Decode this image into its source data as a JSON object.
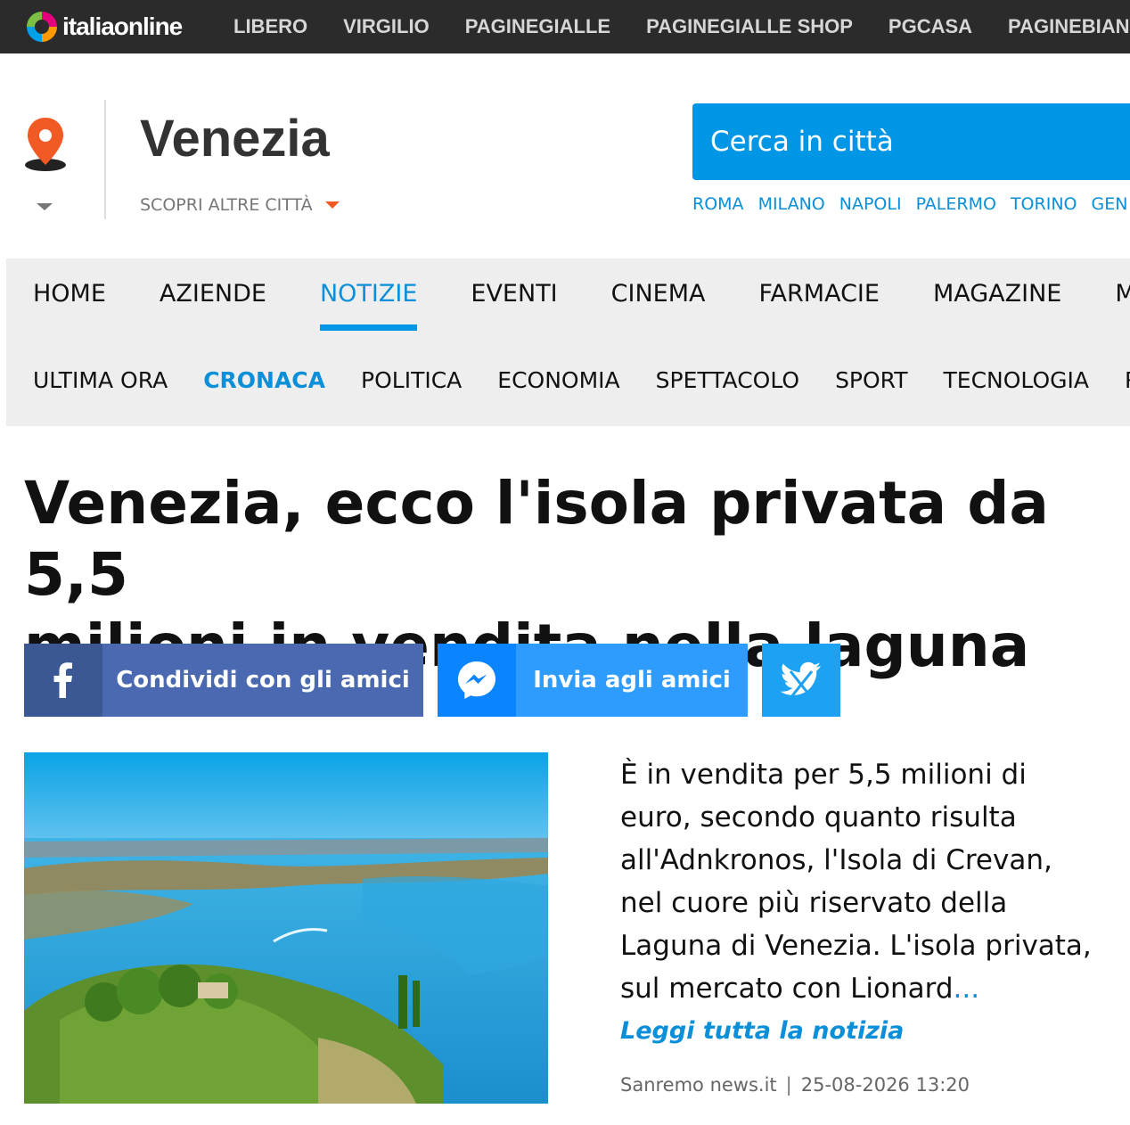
{
  "topbar": {
    "brand": "italiaonline",
    "links": [
      "LIBERO",
      "VIRGILIO",
      "PAGINEGIALLE",
      "PAGINEGIALLE SHOP",
      "PGCASA",
      "PAGINEBIAN"
    ]
  },
  "city": {
    "name": "Venezia",
    "other_cities": "SCOPRI ALTRE CITTÀ",
    "search_placeholder": "Cerca in città",
    "quick_links": [
      "ROMA",
      "MILANO",
      "NAPOLI",
      "PALERMO",
      "TORINO",
      "GEN"
    ]
  },
  "nav": {
    "main": [
      "HOME",
      "AZIENDE",
      "NOTIZIE",
      "EVENTI",
      "CINEMA",
      "FARMACIE",
      "MAGAZINE",
      "M"
    ],
    "main_active": "NOTIZIE",
    "sub": [
      "ULTIMA ORA",
      "CRONACA",
      "POLITICA",
      "ECONOMIA",
      "SPETTACOLO",
      "SPORT",
      "TECNOLOGIA",
      "RA"
    ],
    "sub_active": "CRONACA"
  },
  "article": {
    "headline_line1": "Venezia, ecco l'isola privata da 5,5",
    "headline_line2": "milioni in vendita nella laguna",
    "share_facebook": "Condividi con gli amici",
    "share_messenger": "Invia agli amici",
    "summary_lines": [
      "È in vendita per 5,5 milioni di",
      "euro, secondo quanto risulta",
      "all'Adnkronos, l'Isola di Crevan,",
      "nel cuore più riservato della",
      "Laguna di Venezia. L'isola privata,",
      "sul mercato con Lionard"
    ],
    "summary_ellipsis": "...",
    "read_more": "Leggi tutta la notizia",
    "source": "Sanremo news.it",
    "date": "25-08-2026 13:20"
  },
  "colors": {
    "accent": "#0a8fd8",
    "topbar_bg": "#2b2b2b",
    "facebook": "#4a69b0",
    "messenger": "#2e9bff",
    "twitter": "#1da1f2",
    "pin": "#f15a24"
  },
  "icons": [
    "location-pin-icon",
    "caret-down-icon",
    "facebook-icon",
    "messenger-icon",
    "twitter-icon"
  ]
}
